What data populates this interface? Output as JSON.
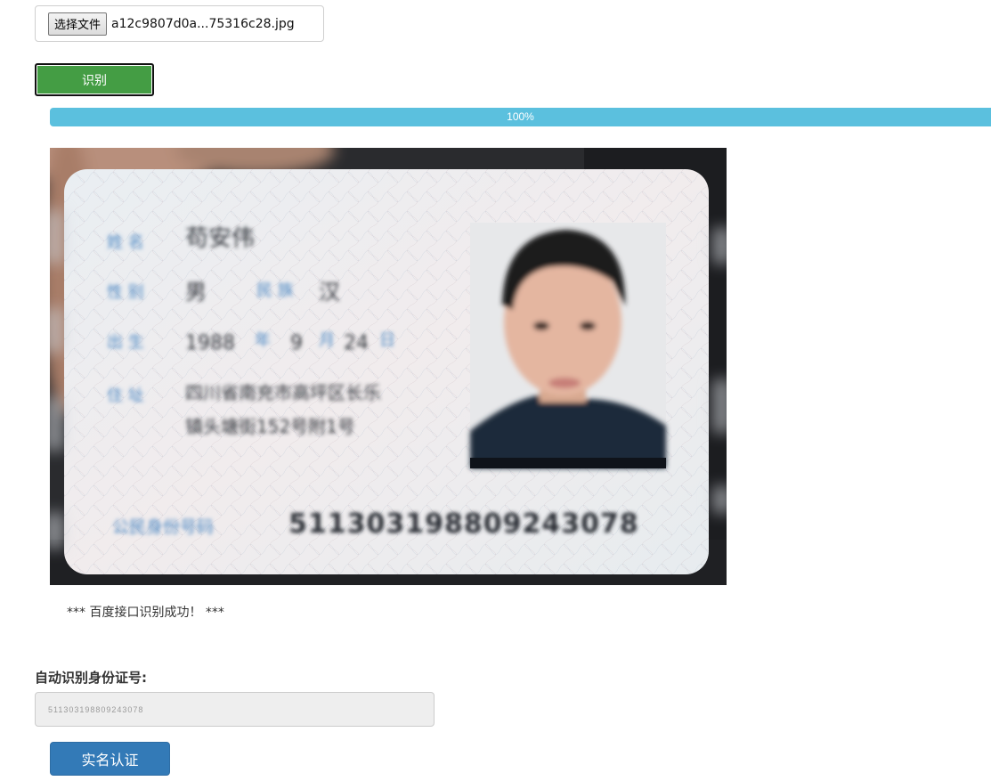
{
  "file_input": {
    "button_label": "选择文件",
    "file_name": "a12c9807d0a...75316c28.jpg"
  },
  "recognize_button": {
    "label": "识别"
  },
  "progress": {
    "value_percent": 100,
    "label": "100%"
  },
  "id_card_image": {
    "name_label": "姓 名",
    "name_value": "苟安伟",
    "sex_label": "性 别",
    "sex_value": "男",
    "nation_label": "民 族",
    "nation_value": "汉",
    "birth_label": "出 生",
    "birth_year": "1988",
    "birth_year_unit": "年",
    "birth_month": "9",
    "birth_month_unit": "月",
    "birth_day": "24",
    "birth_day_unit": "日",
    "address_label": "住 址",
    "address_line1": "四川省南充市高坪区长乐",
    "address_line2": "镇头塘街152号附1号",
    "id_label": "公民身份号码",
    "id_value": "511303198809243078"
  },
  "status_message": "*** 百度接口识别成功！ ***",
  "id_field": {
    "label": "自动识别身份证号:",
    "value": "511303198809243078"
  },
  "verify_button": {
    "label": "实名认证"
  },
  "colors": {
    "recognize_green": "#449d44",
    "progress_blue": "#5bc0de",
    "verify_blue": "#337ab7"
  }
}
